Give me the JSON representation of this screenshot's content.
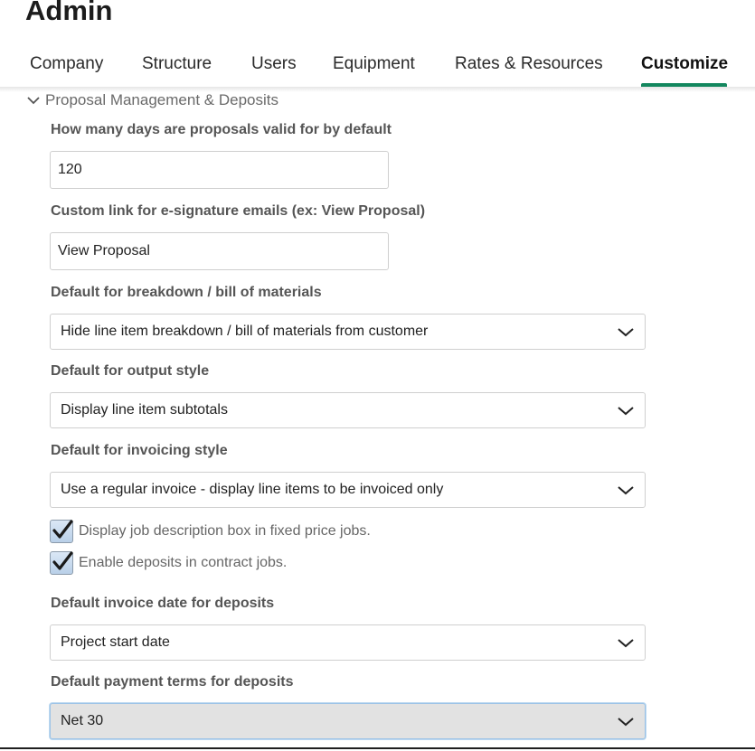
{
  "header": {
    "title": "Admin"
  },
  "tabs": [
    {
      "label": "Company"
    },
    {
      "label": "Structure"
    },
    {
      "label": "Users"
    },
    {
      "label": "Equipment"
    },
    {
      "label": "Rates & Resources"
    },
    {
      "label": "Customize",
      "active": true
    }
  ],
  "section": {
    "title": "Proposal Management & Deposits",
    "expanded": true,
    "icon": "chevron-down-icon"
  },
  "fields": {
    "valid_days": {
      "label": "How many days are proposals valid for by default",
      "value": "120"
    },
    "esign_link": {
      "label": "Custom link for e-signature emails (ex: View Proposal)",
      "value": "View Proposal"
    },
    "breakdown": {
      "label": "Default for breakdown / bill of materials",
      "value": "Hide line item breakdown / bill of materials from customer"
    },
    "output_style": {
      "label": "Default for output style",
      "value": "Display line item subtotals"
    },
    "invoicing_style": {
      "label": "Default for invoicing style",
      "value": "Use a regular invoice - display line items to be invoiced only"
    },
    "deposit_invoice_date": {
      "label": "Default invoice date for deposits",
      "value": "Project start date"
    },
    "deposit_payment_terms": {
      "label": "Default payment terms for deposits",
      "value": "Net 30"
    }
  },
  "checkboxes": {
    "job_description": {
      "label": "Display job description box in fixed price jobs.",
      "checked": true
    },
    "enable_deposits": {
      "label": "Enable deposits in contract jobs.",
      "checked": true
    }
  },
  "colors": {
    "accent": "#13875e",
    "focus_border": "#9cc3e6",
    "checkbox_fill": "#c9dcef"
  }
}
